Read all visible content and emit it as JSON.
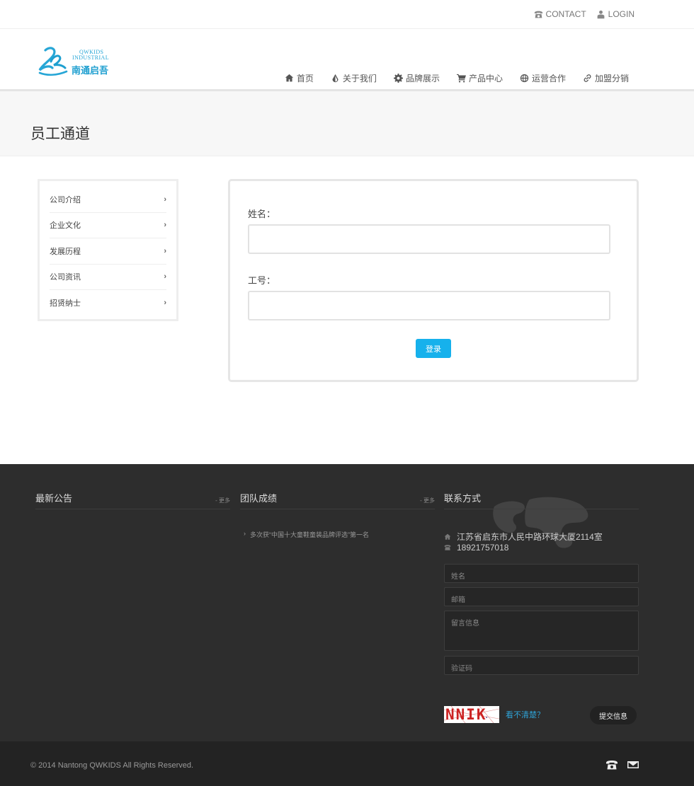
{
  "topbar": {
    "contact_label": "CONTACT",
    "login_label": "LOGIN"
  },
  "logo": {
    "name_en_line1": "QWKIDS",
    "name_en_line2": "INDUSTRIAL",
    "name_cn": "南通启吾",
    "accent": "#27a6d6"
  },
  "nav": {
    "items": [
      {
        "label": "首页",
        "icon": "home-icon"
      },
      {
        "label": "关于我们",
        "icon": "drop-icon"
      },
      {
        "label": "品牌展示",
        "icon": "gear-icon"
      },
      {
        "label": "产品中心",
        "icon": "cart-icon"
      },
      {
        "label": "运营合作",
        "icon": "globe-icon"
      },
      {
        "label": "加盟分销",
        "icon": "link-icon"
      }
    ],
    "active_index": 1
  },
  "page": {
    "title": "员工通道"
  },
  "sidebar": {
    "items": [
      {
        "label": "公司介绍"
      },
      {
        "label": "企业文化"
      },
      {
        "label": "发展历程"
      },
      {
        "label": "公司资讯"
      },
      {
        "label": "招贤纳士"
      }
    ],
    "chevron": "›"
  },
  "login_form": {
    "name_label": "姓名：",
    "name_value": "",
    "id_label": "工号：",
    "id_value": "",
    "submit_label": "登录",
    "button_color": "#16b1ec"
  },
  "footer": {
    "notice": {
      "title": "最新公告",
      "more": "更多"
    },
    "team": {
      "title": "团队成绩",
      "more": "更多",
      "items": [
        {
          "text": "多次获“中国十大童鞋童装品牌评选”第一名"
        }
      ]
    },
    "contact": {
      "title": "联系方式",
      "address": "江苏省启东市人民中路环球大厦2114室",
      "phone": "18921757018",
      "form": {
        "name_placeholder": "姓名",
        "email_placeholder": "邮箱",
        "message_placeholder": "留言信息",
        "captcha_placeholder": "验证码",
        "captcha_code": "NNIK",
        "refresh_label": "看不清楚？",
        "submit_label": "提交信息"
      }
    },
    "copyright": "© 2014  Nantong QWKIDS  All Rights Reserved."
  }
}
